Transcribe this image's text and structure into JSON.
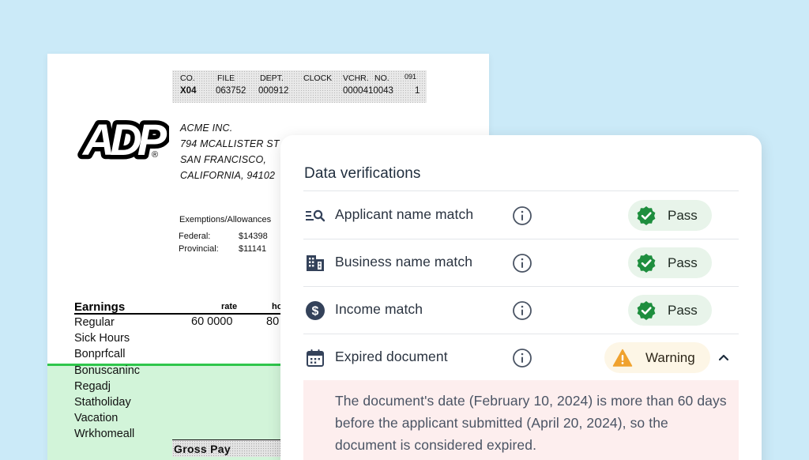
{
  "paystub": {
    "header": {
      "labels": {
        "co": "CO.",
        "file": "FILE",
        "dept": "DEPT.",
        "clock": "CLOCK",
        "vchr": "VCHR.",
        "no": "NO.",
        "code": "091"
      },
      "values": {
        "co": "X04",
        "file": "063752",
        "dept": "000912",
        "vchr": "0000410043",
        "no": "1"
      }
    },
    "logo_icon": "adp-logo",
    "logo_text": "ADP",
    "logo_mark": "®",
    "company": [
      "ACME INC.",
      "794 MCALLISTER ST",
      "SAN FRANCISCO,",
      "CALIFORNIA, 94102"
    ],
    "exemptions_label": "Exemptions/Allowances",
    "exemptions": [
      {
        "label": "Federal:",
        "value": "$14398"
      },
      {
        "label": "Provincial:",
        "value": "$11141"
      }
    ],
    "earnings": {
      "title": "Earnings",
      "rate_label": "rate",
      "hours_label": "ho",
      "items": [
        "Regular",
        "Sick  Hours",
        "Bonprfcall",
        "Bonuscaninc",
        "Regadj",
        "Statholiday",
        "Vacation",
        "Wrkhomeall"
      ],
      "regular_rate": "60  0000",
      "regular_hours": "80"
    },
    "gross_pay_label": "Gross  Pay",
    "highlight_color": "#2fc64c"
  },
  "verification_card": {
    "title": "Data verifications",
    "rows": [
      {
        "icon": "search-list-icon",
        "label": "Applicant name match",
        "status": "Pass",
        "status_type": "pass"
      },
      {
        "icon": "building-icon",
        "label": "Business name match",
        "status": "Pass",
        "status_type": "pass"
      },
      {
        "icon": "dollar-icon",
        "label": "Income match",
        "status": "Pass",
        "status_type": "pass"
      },
      {
        "icon": "calendar-icon",
        "label": "Expired document",
        "status": "Warning",
        "status_type": "warning",
        "expanded": true
      }
    ],
    "info_icon": "info-icon",
    "expand_icon": "chevron-up-icon",
    "warning_detail": "The document's date (February 10, 2024) is more than 60 days before the applicant submitted (April 20, 2024), so the document is considered expired.",
    "colors": {
      "pass_green": "#1e8e3e",
      "pass_bg": "#e8f4ea",
      "warning_orange": "#f0a22e",
      "warning_bg": "#fdf6e6",
      "alert_bg": "#fdeeee",
      "icon_navy": "#34425a",
      "page_bg": "#cbeaf8"
    }
  }
}
